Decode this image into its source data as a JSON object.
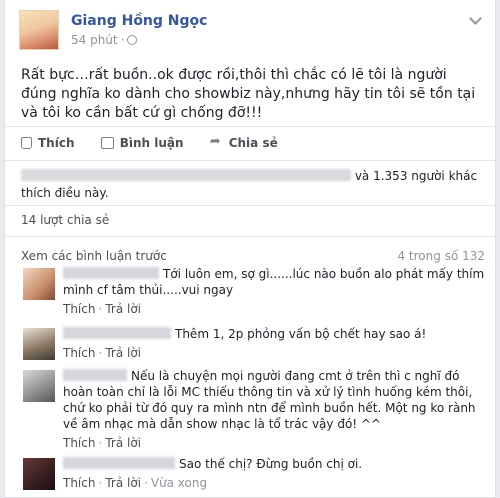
{
  "post": {
    "author": "Giang Hồng Ngọc",
    "time": "54 phút",
    "separator": "·",
    "text": "Rất bực…rất buồn..ok được rồi,thôi thì chắc có lẽ tôi là người đúng nghĩa ko dành cho showbiz này,nhưng hãy tin tôi sẽ tồn tại và tôi ko cần bất cứ gì chống đỡ!!!"
  },
  "actions": {
    "like": "Thích",
    "comment": "Bình luận",
    "share": "Chia sẻ"
  },
  "likes_text": "và 1.353 người khác thích điều này.",
  "shares_text": "14 lượt chia sẻ",
  "comments_header": {
    "more": "Xem các bình luận trước",
    "count": "4 trong số 132"
  },
  "comments": [
    {
      "text": "Tới luôn em, sợ gì......lúc nào buồn alo phát mấy thím mình cf tâm thủi.....vui ngay",
      "like": "Thích",
      "reply": "Trả lời",
      "dot": "·"
    },
    {
      "text": "Thêm 1, 2p phỏng vấn bộ chết hay sao á!",
      "like": "Thích",
      "reply": "Trả lời",
      "dot": "·"
    },
    {
      "text": "Nếu là chuyện mọi người đang cmt ở trên thì c nghĩ đó hoàn toàn chỉ là lỗi MC thiếu thông tin và xử lý tình huống kém thôi, chứ ko phải từ đó quy ra mình ntn để mình buồn hết. Một ng ko rành về âm nhạc mà dẫn show nhạc là tổ trác vậy đó! ^^",
      "like": "Thích",
      "reply": "Trả lời",
      "dot": "·"
    },
    {
      "text": "Sao thế chị? Đừng buồn chị ơi.",
      "like": "Thích",
      "reply": "Trả lời",
      "dot": "·",
      "time": "Vừa xong"
    }
  ],
  "colors": {
    "link": "#365899",
    "meta": "#90949c",
    "background": "#e9ebee"
  },
  "icons": [
    "globe-icon",
    "chevron-down-icon",
    "like-icon",
    "comment-icon",
    "share-icon"
  ]
}
